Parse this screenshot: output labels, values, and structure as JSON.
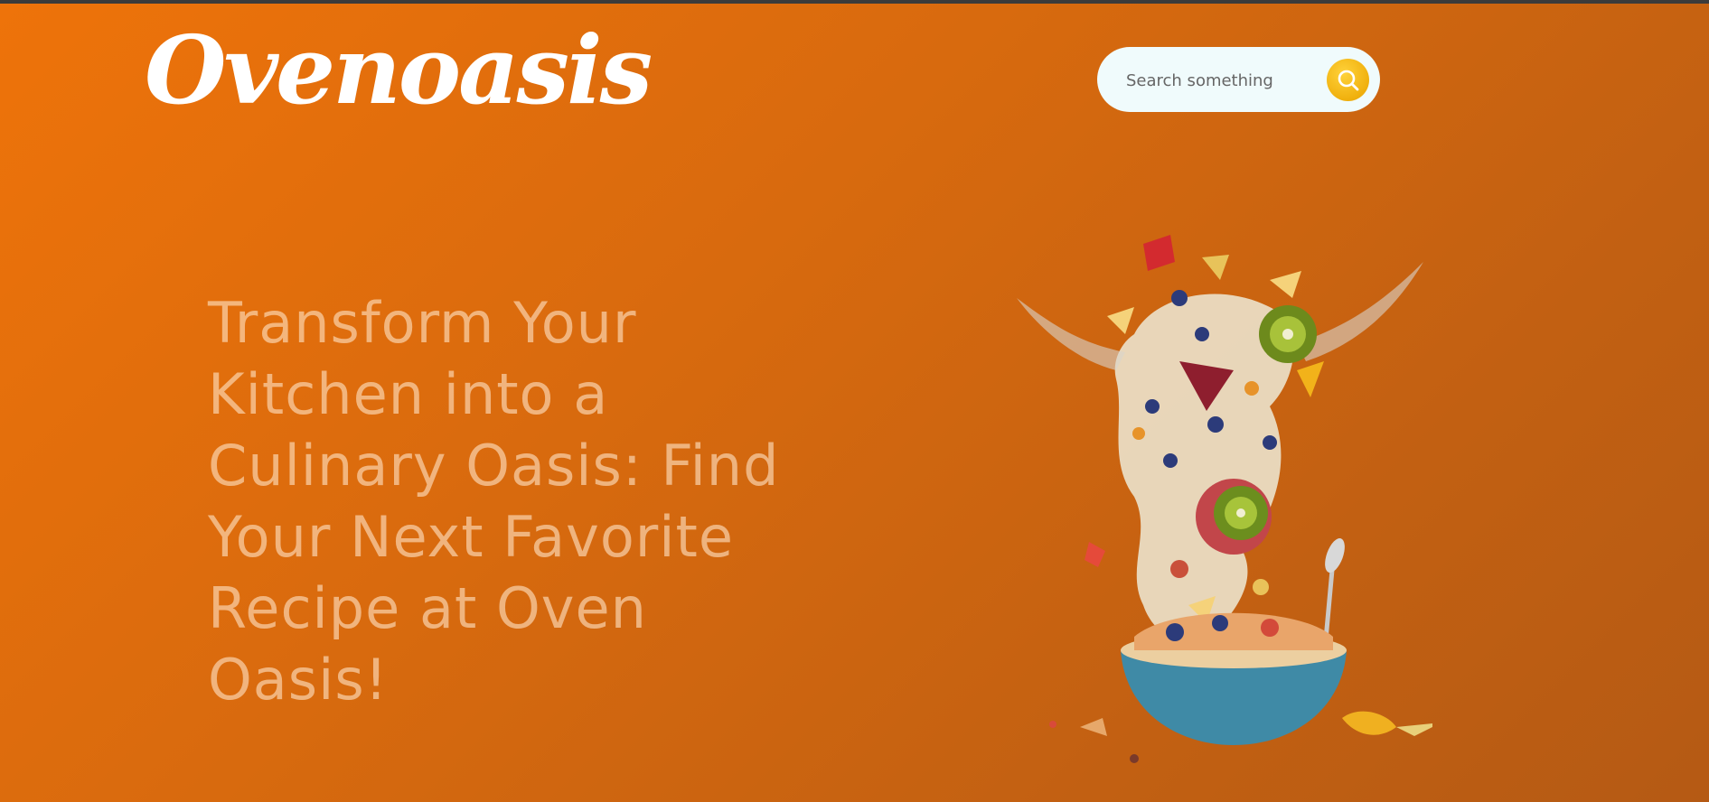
{
  "brand": {
    "logo_text": "Ovenoasis"
  },
  "search": {
    "placeholder": "Search something",
    "button_icon": "search-icon"
  },
  "hero": {
    "headline": "Transform Your Kitchen into a Culinary Oasis: Find Your Next Favorite Recipe at Oven Oasis!",
    "image_icon": "fruit-bowl-splash"
  },
  "colors": {
    "background_start": "#ee730a",
    "background_end": "#b55a14",
    "search_bg": "#f0fbfc",
    "search_button": "#f0b00d",
    "headline": "#ffe2c4"
  }
}
